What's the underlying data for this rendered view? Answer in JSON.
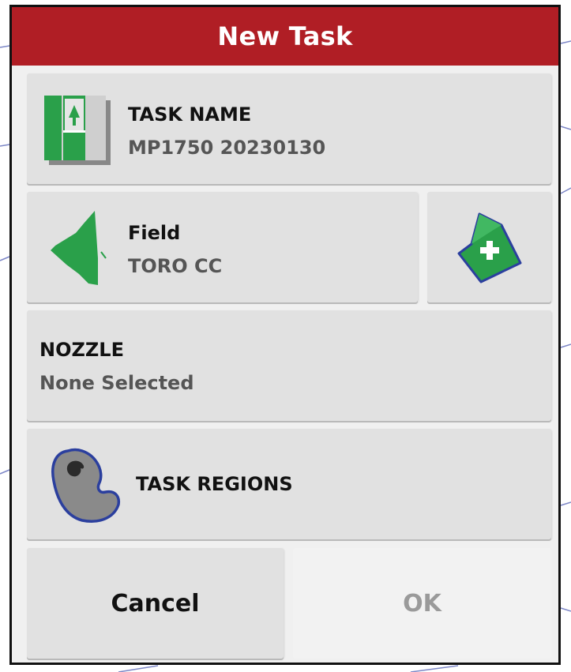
{
  "dialog": {
    "title": "New Task"
  },
  "task_name": {
    "label": "TASK NAME",
    "value": "MP1750 20230130",
    "icon": "task-name-icon"
  },
  "field": {
    "label": "Field",
    "value": "TORO CC",
    "icon": "field-map-icon"
  },
  "add_field": {
    "icon": "add-field-icon"
  },
  "nozzle": {
    "label": "NOZZLE",
    "value": "None Selected"
  },
  "task_regions": {
    "label": "TASK REGIONS",
    "icon": "task-regions-icon"
  },
  "buttons": {
    "cancel": "Cancel",
    "ok": "OK"
  },
  "colors": {
    "title_bar": "#b01e25",
    "icon_green": "#2aa04a",
    "icon_blue": "#2b3f9e"
  }
}
